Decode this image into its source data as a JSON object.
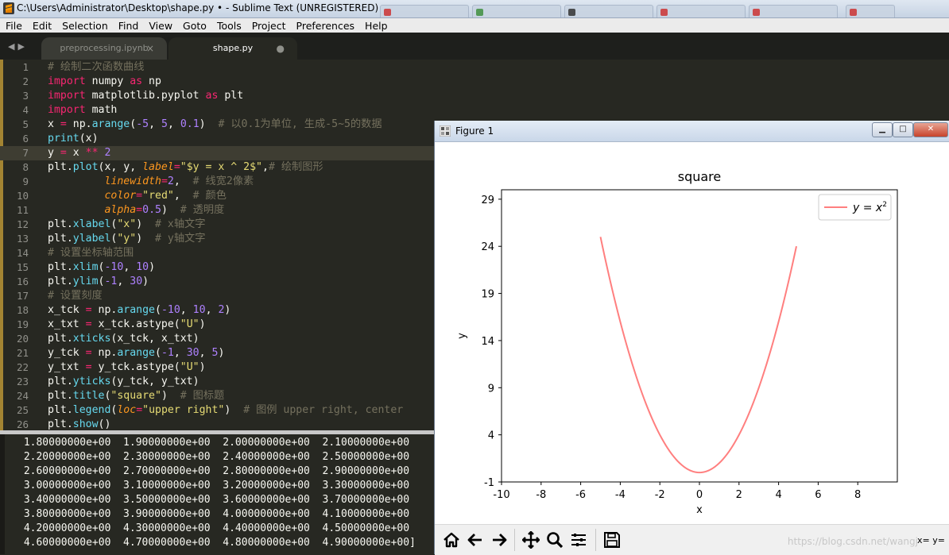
{
  "window": {
    "title": "C:\\Users\\Administrator\\Desktop\\shape.py • - Sublime Text (UNREGISTERED)"
  },
  "menu": [
    "File",
    "Edit",
    "Selection",
    "Find",
    "View",
    "Goto",
    "Tools",
    "Project",
    "Preferences",
    "Help"
  ],
  "tabs": [
    {
      "label": "preprocessing.ipynb",
      "mark": "×",
      "active": false
    },
    {
      "label": "shape.py",
      "mark": "●",
      "active": true
    }
  ],
  "editor": {
    "active_line": 7,
    "lines": [
      [
        [
          "c-cmt",
          "# 绘制二次函数曲线"
        ]
      ],
      [
        [
          "c-kw",
          "import"
        ],
        [
          "",
          " numpy "
        ],
        [
          "c-kw",
          "as"
        ],
        [
          "",
          " np"
        ]
      ],
      [
        [
          "c-kw",
          "import"
        ],
        [
          "",
          " matplotlib.pyplot "
        ],
        [
          "c-kw",
          "as"
        ],
        [
          "",
          " plt"
        ]
      ],
      [
        [
          "c-kw",
          "import"
        ],
        [
          "",
          " math"
        ]
      ],
      [
        [
          "",
          "x "
        ],
        [
          "c-op",
          "="
        ],
        [
          "",
          " np."
        ],
        [
          "c-fn",
          "arange"
        ],
        [
          "",
          "("
        ],
        [
          "c-num",
          "-5"
        ],
        [
          "",
          ", "
        ],
        [
          "c-num",
          "5"
        ],
        [
          "",
          ", "
        ],
        [
          "c-num",
          "0.1"
        ],
        [
          "",
          ")  "
        ],
        [
          "c-cmt",
          "# 以0.1为单位, 生成-5~5的数据"
        ]
      ],
      [
        [
          "c-fn",
          "print"
        ],
        [
          "",
          "(x)"
        ]
      ],
      [
        [
          "",
          "y "
        ],
        [
          "c-op",
          "="
        ],
        [
          "",
          " x "
        ],
        [
          "c-op",
          "**"
        ],
        [
          "",
          " "
        ],
        [
          "c-num",
          "2"
        ]
      ],
      [
        [
          "",
          "plt."
        ],
        [
          "c-fn",
          "plot"
        ],
        [
          "",
          "(x, y, "
        ],
        [
          "c-arg",
          "label"
        ],
        [
          "c-op",
          "="
        ],
        [
          "c-str",
          "\"$y = x ^ 2$\""
        ],
        [
          "",
          ","
        ],
        [
          "c-cmt",
          "# 绘制图形"
        ]
      ],
      [
        [
          "",
          "         "
        ],
        [
          "c-arg",
          "linewidth"
        ],
        [
          "c-op",
          "="
        ],
        [
          "c-num",
          "2"
        ],
        [
          "",
          ",  "
        ],
        [
          "c-cmt",
          "# 线宽2像素"
        ]
      ],
      [
        [
          "",
          "         "
        ],
        [
          "c-arg",
          "color"
        ],
        [
          "c-op",
          "="
        ],
        [
          "c-str",
          "\"red\""
        ],
        [
          "",
          ",  "
        ],
        [
          "c-cmt",
          "# 颜色"
        ]
      ],
      [
        [
          "",
          "         "
        ],
        [
          "c-arg",
          "alpha"
        ],
        [
          "c-op",
          "="
        ],
        [
          "c-num",
          "0.5"
        ],
        [
          "",
          ")  "
        ],
        [
          "c-cmt",
          "# 透明度"
        ]
      ],
      [
        [
          "",
          "plt."
        ],
        [
          "c-fn",
          "xlabel"
        ],
        [
          "",
          "("
        ],
        [
          "c-str",
          "\"x\""
        ],
        [
          "",
          ")  "
        ],
        [
          "c-cmt",
          "# x轴文字"
        ]
      ],
      [
        [
          "",
          "plt."
        ],
        [
          "c-fn",
          "ylabel"
        ],
        [
          "",
          "("
        ],
        [
          "c-str",
          "\"y\""
        ],
        [
          "",
          ")  "
        ],
        [
          "c-cmt",
          "# y轴文字"
        ]
      ],
      [
        [
          "c-cmt",
          "# 设置坐标轴范围"
        ]
      ],
      [
        [
          "",
          "plt."
        ],
        [
          "c-fn",
          "xlim"
        ],
        [
          "",
          "("
        ],
        [
          "c-num",
          "-10"
        ],
        [
          "",
          ", "
        ],
        [
          "c-num",
          "10"
        ],
        [
          "",
          ")"
        ]
      ],
      [
        [
          "",
          "plt."
        ],
        [
          "c-fn",
          "ylim"
        ],
        [
          "",
          "("
        ],
        [
          "c-num",
          "-1"
        ],
        [
          "",
          ", "
        ],
        [
          "c-num",
          "30"
        ],
        [
          "",
          ")"
        ]
      ],
      [
        [
          "c-cmt",
          "# 设置刻度"
        ]
      ],
      [
        [
          "",
          "x_tck "
        ],
        [
          "c-op",
          "="
        ],
        [
          "",
          " np."
        ],
        [
          "c-fn",
          "arange"
        ],
        [
          "",
          "("
        ],
        [
          "c-num",
          "-10"
        ],
        [
          "",
          ", "
        ],
        [
          "c-num",
          "10"
        ],
        [
          "",
          ", "
        ],
        [
          "c-num",
          "2"
        ],
        [
          "",
          ")"
        ]
      ],
      [
        [
          "",
          "x_txt "
        ],
        [
          "c-op",
          "="
        ],
        [
          "",
          " x_tck.astype("
        ],
        [
          "c-str",
          "\"U\""
        ],
        [
          "",
          ")"
        ]
      ],
      [
        [
          "",
          "plt."
        ],
        [
          "c-fn",
          "xticks"
        ],
        [
          "",
          "(x_tck, x_txt)"
        ]
      ],
      [
        [
          "",
          "y_tck "
        ],
        [
          "c-op",
          "="
        ],
        [
          "",
          " np."
        ],
        [
          "c-fn",
          "arange"
        ],
        [
          "",
          "("
        ],
        [
          "c-num",
          "-1"
        ],
        [
          "",
          ", "
        ],
        [
          "c-num",
          "30"
        ],
        [
          "",
          ", "
        ],
        [
          "c-num",
          "5"
        ],
        [
          "",
          ")"
        ]
      ],
      [
        [
          "",
          "y_txt "
        ],
        [
          "c-op",
          "="
        ],
        [
          "",
          " y_tck.astype("
        ],
        [
          "c-str",
          "\"U\""
        ],
        [
          "",
          ")"
        ]
      ],
      [
        [
          "",
          "plt."
        ],
        [
          "c-fn",
          "yticks"
        ],
        [
          "",
          "(y_tck, y_txt)"
        ]
      ],
      [
        [
          "",
          "plt."
        ],
        [
          "c-fn",
          "title"
        ],
        [
          "",
          "("
        ],
        [
          "c-str",
          "\"square\""
        ],
        [
          "",
          ")  "
        ],
        [
          "c-cmt",
          "# 图标题"
        ]
      ],
      [
        [
          "",
          "plt."
        ],
        [
          "c-fn",
          "legend"
        ],
        [
          "",
          "("
        ],
        [
          "c-arg",
          "loc"
        ],
        [
          "c-op",
          "="
        ],
        [
          "c-str",
          "\"upper right\""
        ],
        [
          "",
          ")  "
        ],
        [
          "c-cmt",
          "# 图例 upper right, center"
        ]
      ],
      [
        [
          "",
          "plt."
        ],
        [
          "c-fn",
          "show"
        ],
        [
          "",
          "()"
        ]
      ]
    ]
  },
  "console": {
    "lines": [
      " 1.80000000e+00  1.90000000e+00  2.00000000e+00  2.10000000e+00",
      " 2.20000000e+00  2.30000000e+00  2.40000000e+00  2.50000000e+00",
      " 2.60000000e+00  2.70000000e+00  2.80000000e+00  2.90000000e+00",
      " 3.00000000e+00  3.10000000e+00  3.20000000e+00  3.30000000e+00",
      " 3.40000000e+00  3.50000000e+00  3.60000000e+00  3.70000000e+00",
      " 3.80000000e+00  3.90000000e+00  4.00000000e+00  4.10000000e+00",
      " 4.20000000e+00  4.30000000e+00  4.40000000e+00  4.50000000e+00",
      " 4.60000000e+00  4.70000000e+00  4.80000000e+00  4.90000000e+00]"
    ]
  },
  "figure": {
    "window_title": "Figure 1",
    "buttons": {
      "minimize": "▁",
      "maximize": "□",
      "close": "✕"
    },
    "coords_text": "x= y=",
    "watermark": "https://blog.csdn.net/wangj",
    "toolbar_icons": [
      "home-icon",
      "back-arrow-icon",
      "forward-arrow-icon",
      "pan-icon",
      "zoom-icon",
      "configure-subplots-icon",
      "save-icon"
    ]
  },
  "chart_data": {
    "type": "line",
    "title": "square",
    "xlabel": "x",
    "ylabel": "y",
    "xlim": [
      -10,
      10
    ],
    "ylim": [
      -1,
      30
    ],
    "xticks": [
      -10,
      -8,
      -6,
      -4,
      -2,
      0,
      2,
      4,
      6,
      8
    ],
    "xtick_labels": [
      "-10",
      "-8",
      "-6",
      "-4",
      "-2",
      "0",
      "2",
      "4",
      "6",
      "8"
    ],
    "yticks": [
      -1,
      4,
      9,
      14,
      19,
      24,
      29
    ],
    "ytick_labels": [
      "-1",
      "4",
      "9",
      "14",
      "19",
      "24",
      "29"
    ],
    "series": [
      {
        "name": "y = x",
        "superscript": "2",
        "color": "#ff0000",
        "alpha": 0.5,
        "linewidth": 2,
        "x_start": -5,
        "x_end": 4.9,
        "x_step": 0.1,
        "function": "x^2"
      }
    ],
    "legend": {
      "loc": "upper right"
    },
    "grid": false
  }
}
